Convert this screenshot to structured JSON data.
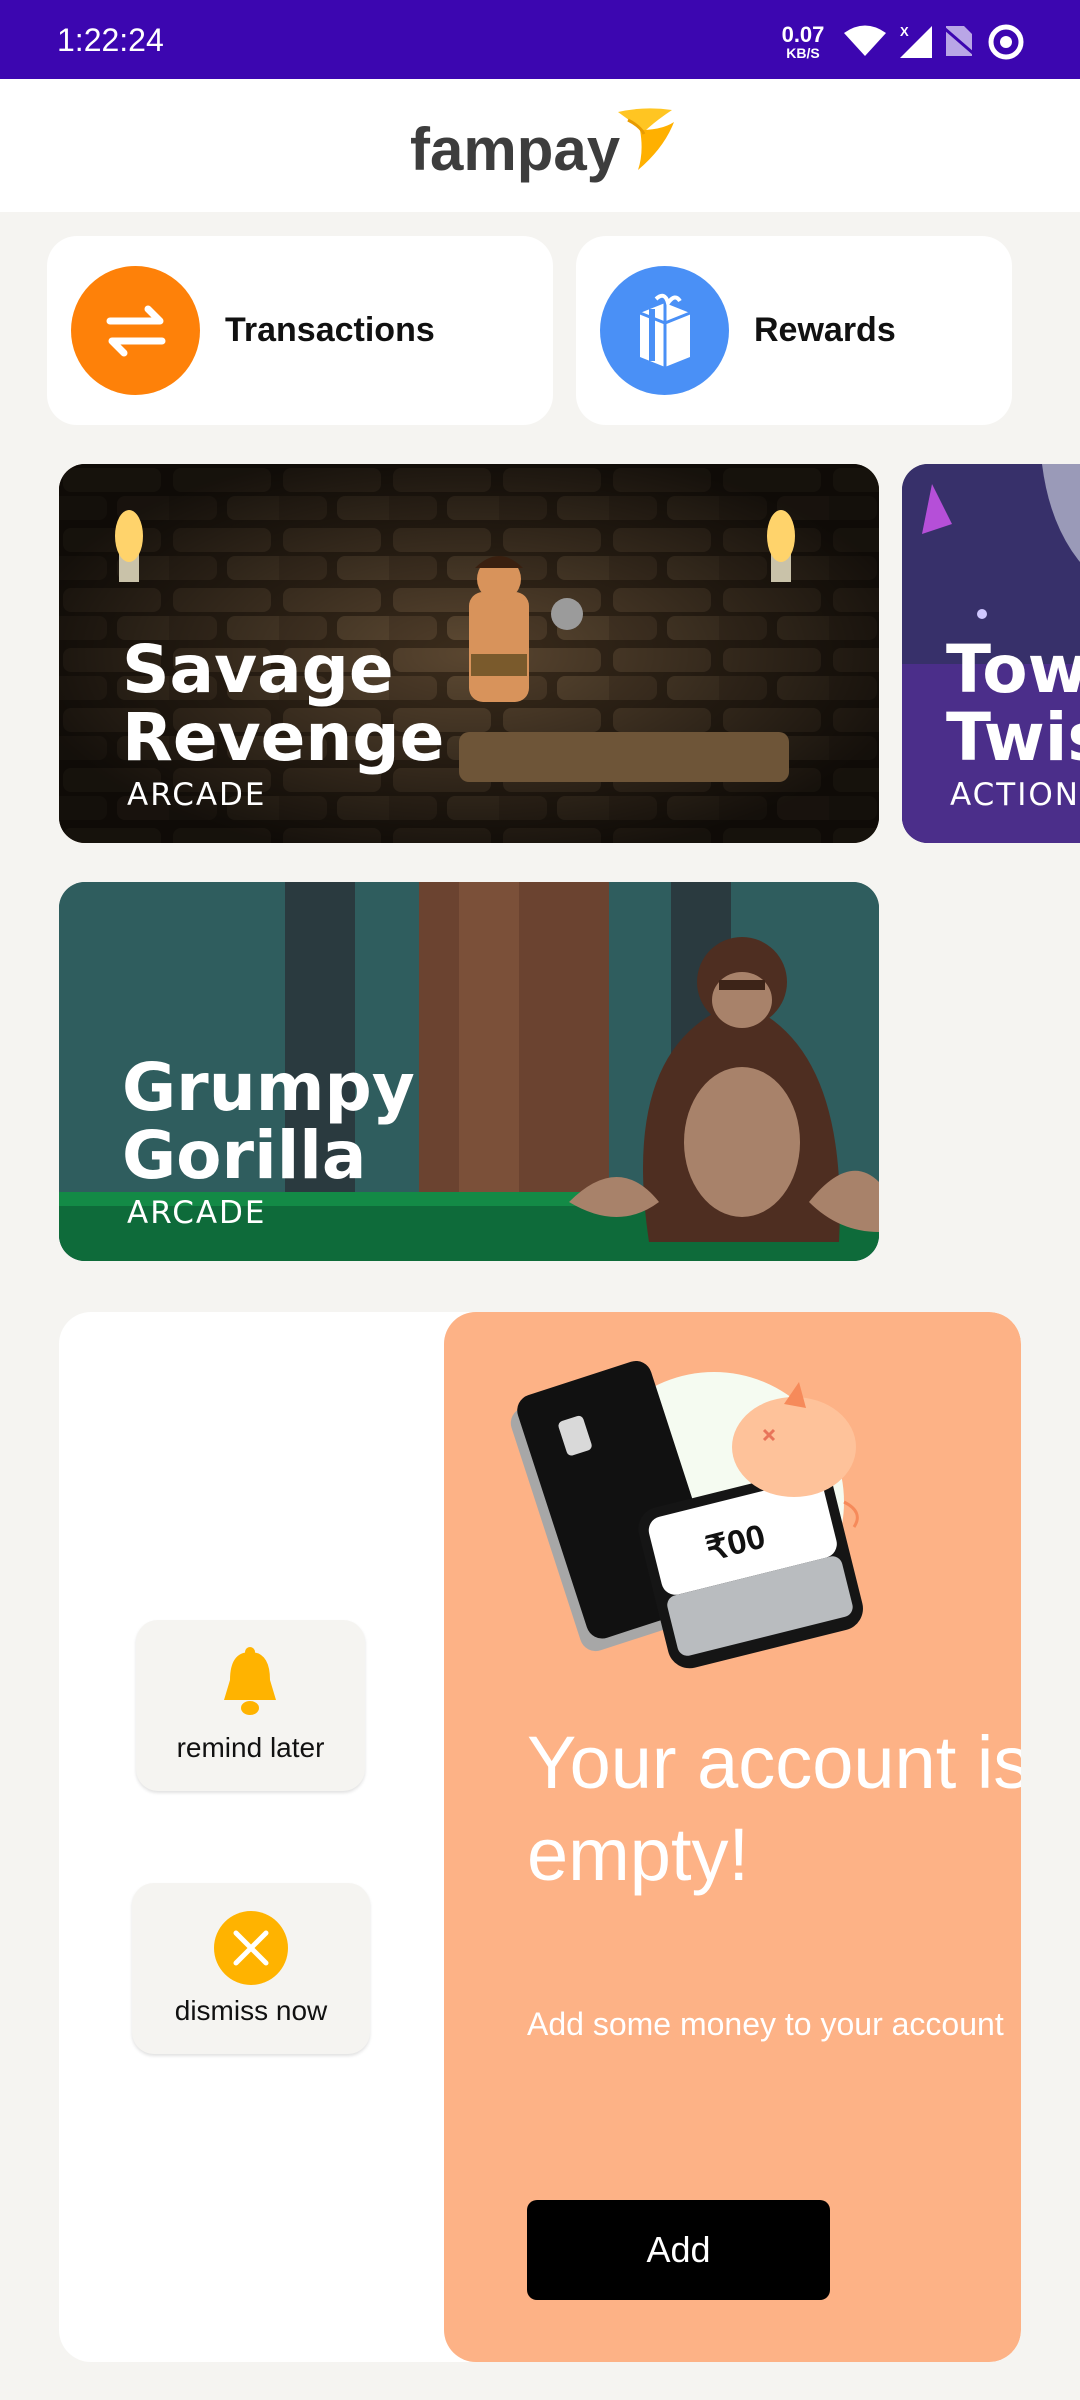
{
  "status_bar": {
    "time": "1:22:24",
    "net_speed_value": "0.07",
    "net_speed_unit": "KB/S",
    "icons": [
      "wifi-icon",
      "signal-icon",
      "no-sim-icon",
      "target-icon"
    ]
  },
  "header": {
    "brand": "fampay",
    "logo_icon": "bird-logo-icon"
  },
  "quick_actions": [
    {
      "label": "Transactions",
      "icon": "arrows-swap-icon",
      "color": "#fe8109"
    },
    {
      "label": "Rewards",
      "icon": "gift-icon",
      "color": "#4a90f6"
    }
  ],
  "games": [
    {
      "title_line1": "Savage",
      "title_line2": "Revenge",
      "genre": "ARCADE"
    },
    {
      "title_line1": "Tow",
      "title_line2": "Twis",
      "genre": "ACTION"
    },
    {
      "title_line1": "Grumpy",
      "title_line2": "Gorilla",
      "genre": "ARCADE"
    }
  ],
  "promo": {
    "remind_label": "remind later",
    "dismiss_label": "dismiss now",
    "title_line1": "Your account is",
    "title_line2": "empty!",
    "subtitle": "Add some money to your account",
    "add_label": "Add",
    "amount_text": "₹00",
    "bg_color": "#fdb286"
  }
}
